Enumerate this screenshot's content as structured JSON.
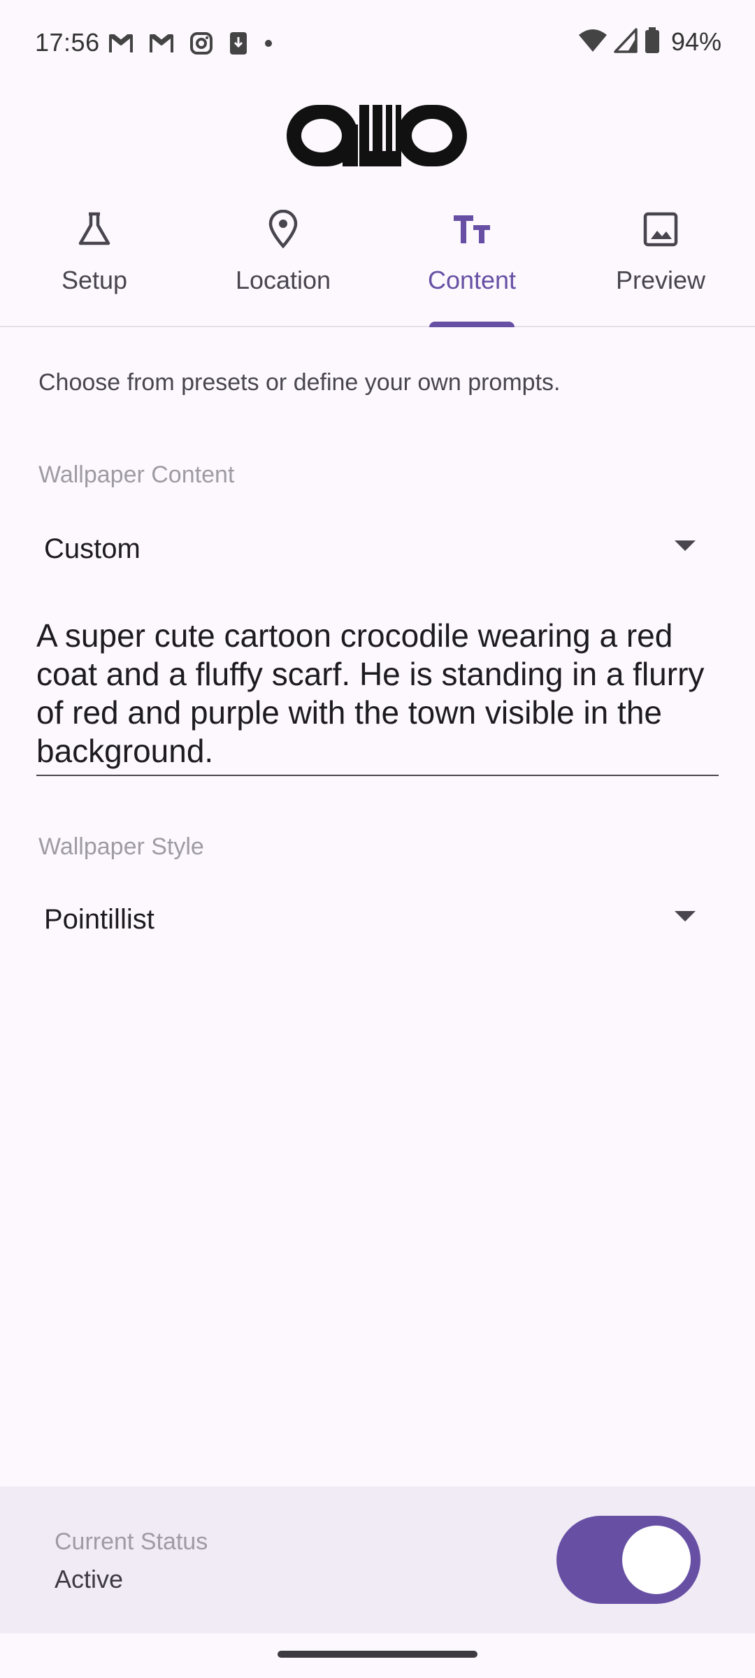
{
  "status_bar": {
    "time": "17:56",
    "left_icons": [
      "gmail-icon",
      "gmail-icon",
      "instagram-icon",
      "download-icon",
      "dot-icon"
    ],
    "right_icons": [
      "wifi-icon",
      "signal-icon",
      "battery-icon"
    ],
    "battery": "94%"
  },
  "app": {
    "logo_name": "app-logo"
  },
  "tabs": [
    {
      "label": "Setup",
      "icon": "flask-icon",
      "active": false
    },
    {
      "label": "Location",
      "icon": "location-pin-icon",
      "active": false
    },
    {
      "label": "Content",
      "icon": "text-fields-icon",
      "active": true
    },
    {
      "label": "Preview",
      "icon": "image-icon",
      "active": false
    }
  ],
  "content": {
    "description": "Choose from presets or define your own prompts.",
    "wallpaper_content": {
      "label": "Wallpaper Content",
      "selected": "Custom"
    },
    "prompt": "A super cute cartoon crocodile wearing a red coat and a fluffy scarf. He is standing in a flurry of red and purple with the town visible in the background.",
    "wallpaper_style": {
      "label": "Wallpaper Style",
      "selected": "Pointillist"
    }
  },
  "status_panel": {
    "label": "Current Status",
    "value": "Active",
    "toggle_on": true
  },
  "colors": {
    "accent": "#6750A4",
    "background": "#FCF8FD",
    "panel": "#F1EBF5"
  }
}
